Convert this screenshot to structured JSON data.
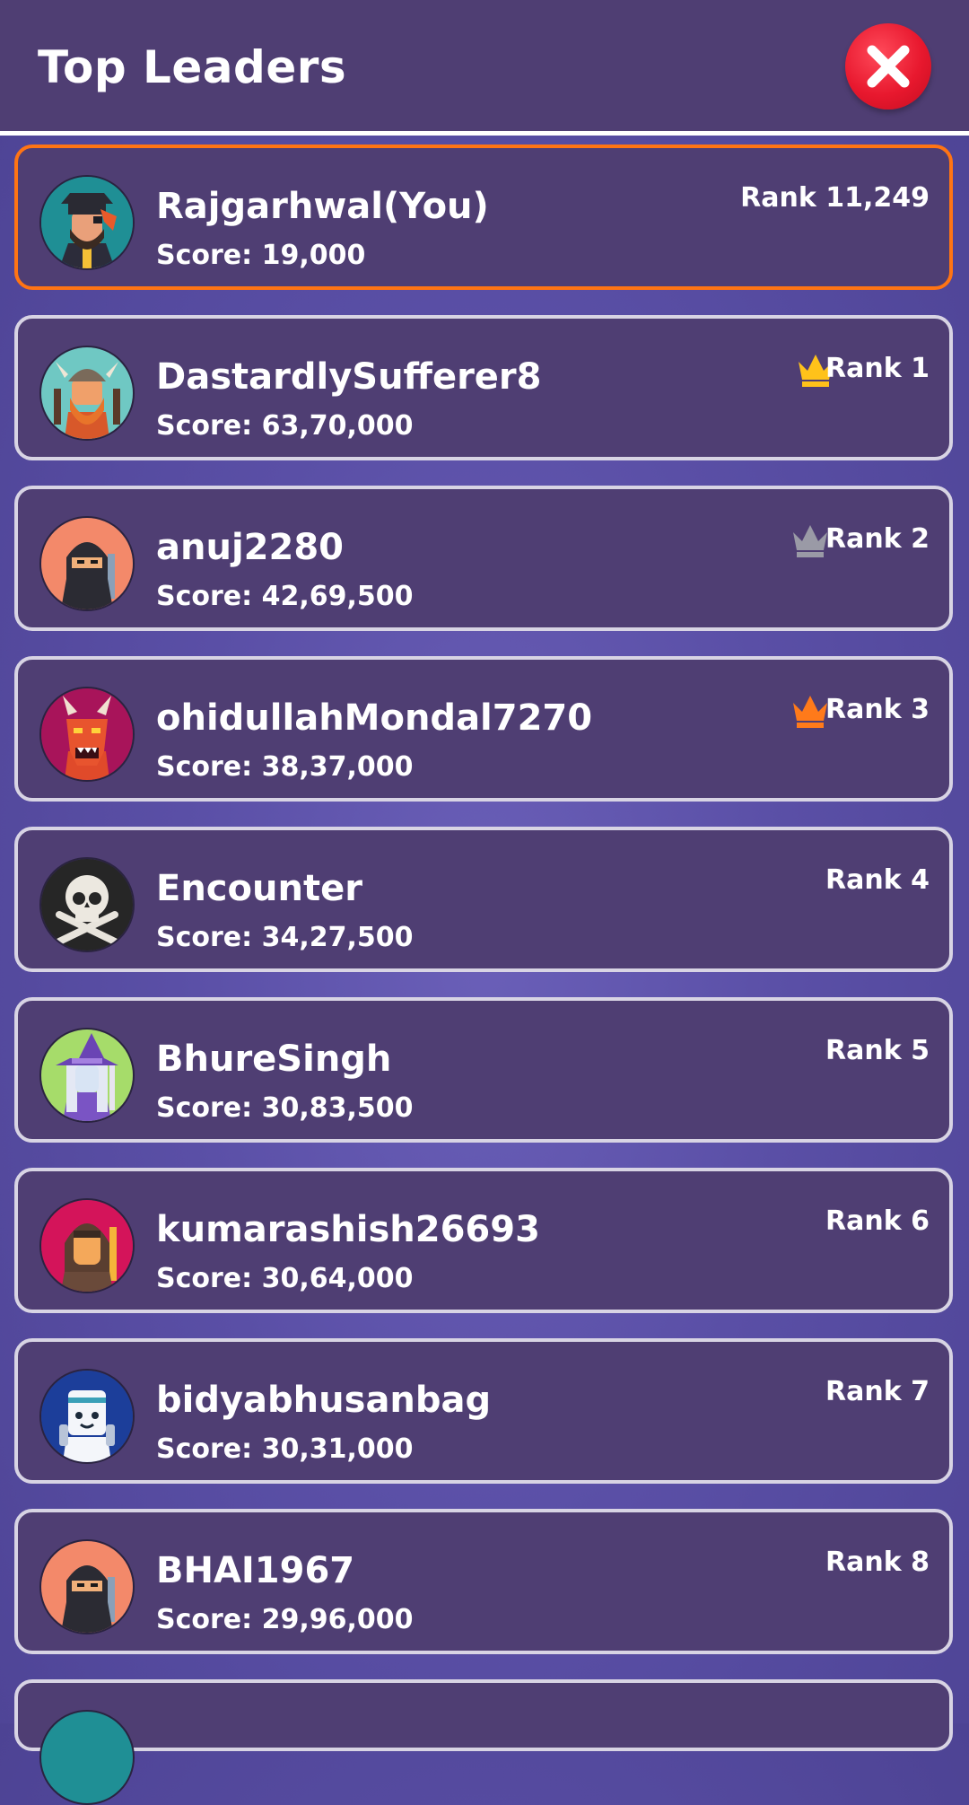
{
  "header": {
    "title": "Top Leaders"
  },
  "leaders": [
    {
      "name": "Rajgarhwal(You)",
      "score": "Score: 19,000",
      "rank": "Rank 11,249",
      "avatar": "pirate-avatar-icon",
      "crown": null
    },
    {
      "name": "DastardlySufferer8",
      "score": "Score: 63,70,000",
      "rank": "Rank 1",
      "avatar": "viking-avatar-icon",
      "crown": "#ffc21a"
    },
    {
      "name": "anuj2280",
      "score": "Score: 42,69,500",
      "rank": "Rank 2",
      "avatar": "ninja-avatar-icon",
      "crown": "#9a9aa6"
    },
    {
      "name": "ohidullahMondal7270",
      "score": "Score: 38,37,000",
      "rank": "Rank 3",
      "avatar": "dragon-avatar-icon",
      "crown": "#ff7a1a"
    },
    {
      "name": "Encounter",
      "score": "Score: 34,27,500",
      "rank": "Rank 4",
      "avatar": "skull-avatar-icon",
      "crown": null
    },
    {
      "name": "BhureSingh",
      "score": "Score: 30,83,500",
      "rank": "Rank 5",
      "avatar": "witch-avatar-icon",
      "crown": null
    },
    {
      "name": "kumarashish26693",
      "score": "Score: 30,64,000",
      "rank": "Rank 6",
      "avatar": "warrior-avatar-icon",
      "crown": null
    },
    {
      "name": "bidyabhusanbag",
      "score": "Score: 30,31,000",
      "rank": "Rank 7",
      "avatar": "robot-avatar-icon",
      "crown": null
    },
    {
      "name": "BHAI1967",
      "score": "Score: 29,96,000",
      "rank": "Rank 8",
      "avatar": "ninja-avatar-icon",
      "crown": null
    }
  ]
}
